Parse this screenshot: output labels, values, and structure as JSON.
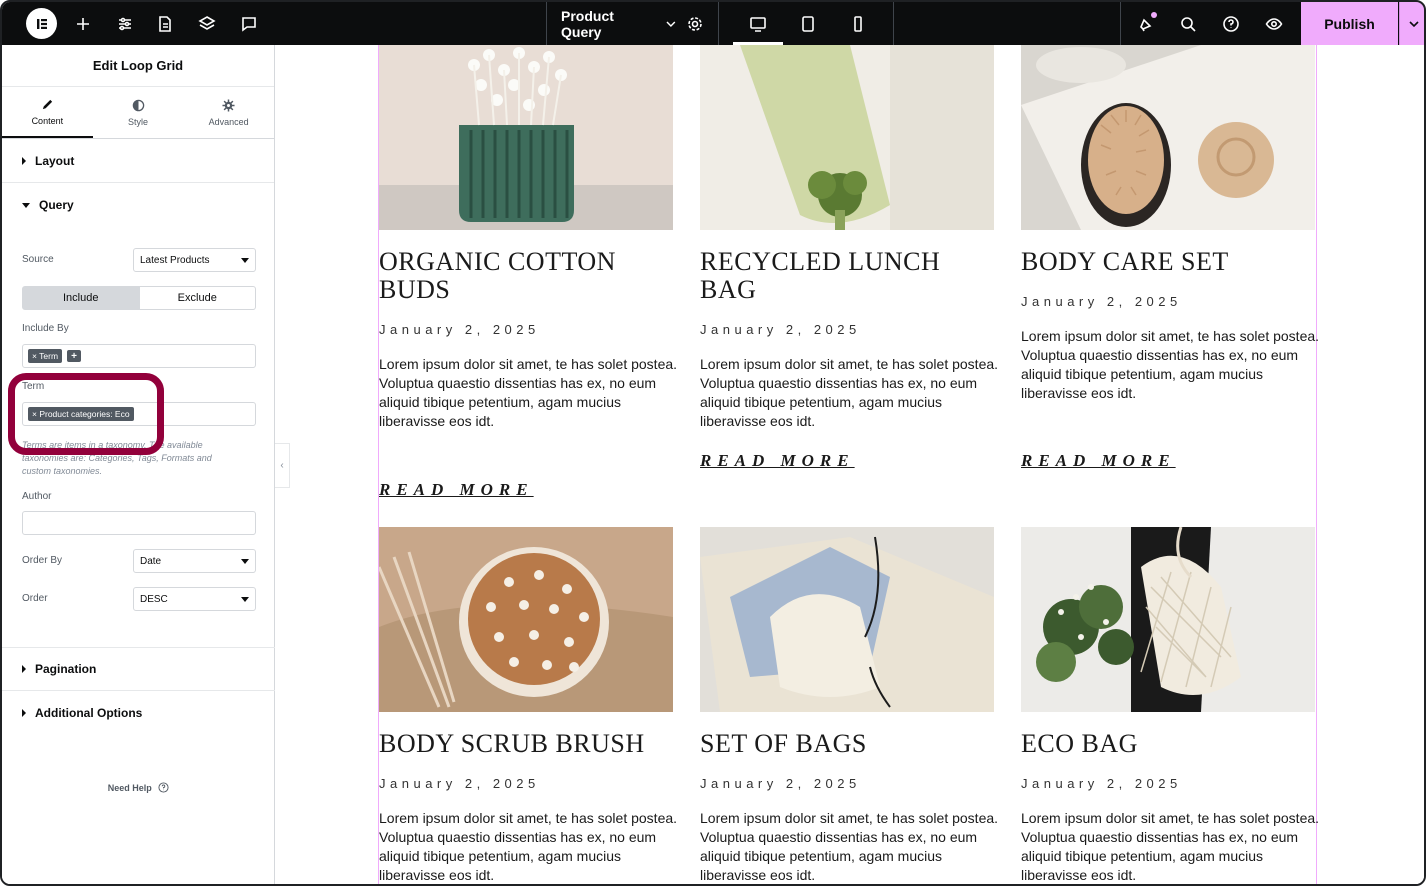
{
  "topbar": {
    "document_title": "Product Query",
    "publish_label": "Publish",
    "icons": [
      "elementor-logo-icon",
      "add-icon",
      "site-settings-icon",
      "page-icon",
      "layers-icon",
      "comments-icon",
      "chevron-down-icon",
      "settings-gear-icon",
      "desktop-icon",
      "tablet-icon",
      "mobile-icon",
      "notifications-icon",
      "search-icon",
      "help-icon",
      "preview-eye-icon"
    ]
  },
  "panel": {
    "title": "Edit Loop Grid",
    "tabs": [
      {
        "label": "Content",
        "icon": "pencil-icon",
        "active": true
      },
      {
        "label": "Style",
        "icon": "half-circle-icon",
        "active": false
      },
      {
        "label": "Advanced",
        "icon": "gear-icon",
        "active": false
      }
    ],
    "sections": {
      "layout": "Layout",
      "query": "Query",
      "pagination": "Pagination",
      "additional": "Additional Options"
    },
    "query": {
      "source_label": "Source",
      "source_value": "Latest Products",
      "include_label": "Include",
      "exclude_label": "Exclude",
      "include_by_label": "Include By",
      "include_by_tag": "× Term",
      "add_label": "+",
      "term_label": "Term",
      "term_tag": "× Product categories: Eco",
      "term_hint": "Terms are items in a taxonomy. The available taxonomies are: Categories, Tags, Formats and custom taxonomies.",
      "author_label": "Author",
      "author_value": "",
      "order_by_label": "Order By",
      "order_by_value": "Date",
      "order_label": "Order",
      "order_value": "DESC"
    },
    "need_help": "Need Help",
    "collapse_glyph": "‹"
  },
  "cards": [
    {
      "title": "Organic Cotton Buds",
      "date": "January 2, 2025",
      "text": "Lorem ipsum dolor sit amet, te has solet postea. Voluptua quaestio dissentias has ex, no eum aliquid tibique petentium, agam mucius liberavisse eos idt.",
      "more": "READ MORE"
    },
    {
      "title": "Recycled Lunch Bag",
      "date": "January 2, 2025",
      "text": "Lorem ipsum dolor sit amet, te has solet postea. Voluptua quaestio dissentias has ex, no eum aliquid tibique petentium, agam mucius liberavisse eos idt.",
      "more": "READ MORE"
    },
    {
      "title": "Body Care Set",
      "date": "January 2, 2025",
      "text": "Lorem ipsum dolor sit amet, te has solet postea. Voluptua quaestio dissentias has ex, no eum aliquid tibique petentium, agam mucius liberavisse eos idt.",
      "more": "READ MORE"
    },
    {
      "title": "Body Scrub Brush",
      "date": "January 2, 2025",
      "text": "Lorem ipsum dolor sit amet, te has solet postea. Voluptua quaestio dissentias has ex, no eum aliquid tibique petentium, agam mucius liberavisse eos idt.",
      "more": ""
    },
    {
      "title": "Set of Bags",
      "date": "January 2, 2025",
      "text": "Lorem ipsum dolor sit amet, te has solet postea. Voluptua quaestio dissentias has ex, no eum aliquid tibique petentium, agam mucius liberavisse eos idt.",
      "more": ""
    },
    {
      "title": "Eco Bag",
      "date": "January 2, 2025",
      "text": "Lorem ipsum dolor sit amet, te has solet postea. Voluptua quaestio dissentias has ex, no eum aliquid tibique petentium, agam mucius liberavisse eos idt.",
      "more": ""
    }
  ],
  "colors": {
    "topbar_bg": "#0c0d0e",
    "accent_pink": "#f0abfc",
    "highlight": "#92003b"
  }
}
